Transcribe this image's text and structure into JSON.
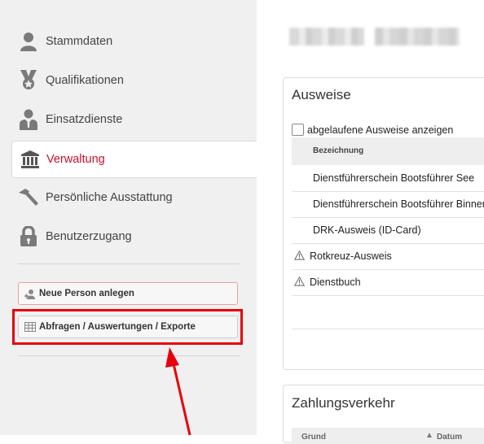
{
  "sidebar": {
    "items": [
      {
        "label": "Stammdaten",
        "icon": "person-icon"
      },
      {
        "label": "Qualifikationen",
        "icon": "medal-icon"
      },
      {
        "label": "Einsatzdienste",
        "icon": "staff-person-icon"
      },
      {
        "label": "Verwaltung",
        "icon": "building-icon",
        "active": true
      },
      {
        "label": "Persönliche Ausstattung",
        "icon": "hammer-icon"
      },
      {
        "label": "Benutzerzugang",
        "icon": "lock-icon"
      }
    ],
    "new_person_label": "Neue Person anlegen",
    "reports_label": "Abfragen / Auswertungen / Exporte"
  },
  "ausweise": {
    "title": "Ausweise",
    "checkbox_label": "abgelaufene Ausweise anzeigen",
    "column_header": "Bezeichnung",
    "rows": [
      {
        "label": "Dienstführerschein Bootsführer See",
        "warning": false
      },
      {
        "label": "Dienstführerschein Bootsführer Binnen",
        "warning": false
      },
      {
        "label": "DRK-Ausweis (ID-Card)",
        "warning": false
      },
      {
        "label": "Rotkreuz-Ausweis",
        "warning": true
      },
      {
        "label": "Dienstbuch",
        "warning": true
      }
    ]
  },
  "zahlungsverkehr": {
    "title": "Zahlungsverkehr",
    "columns": [
      "Grund",
      "Datum"
    ]
  },
  "colors": {
    "active": "#c8102e",
    "highlight": "#e8000b"
  }
}
